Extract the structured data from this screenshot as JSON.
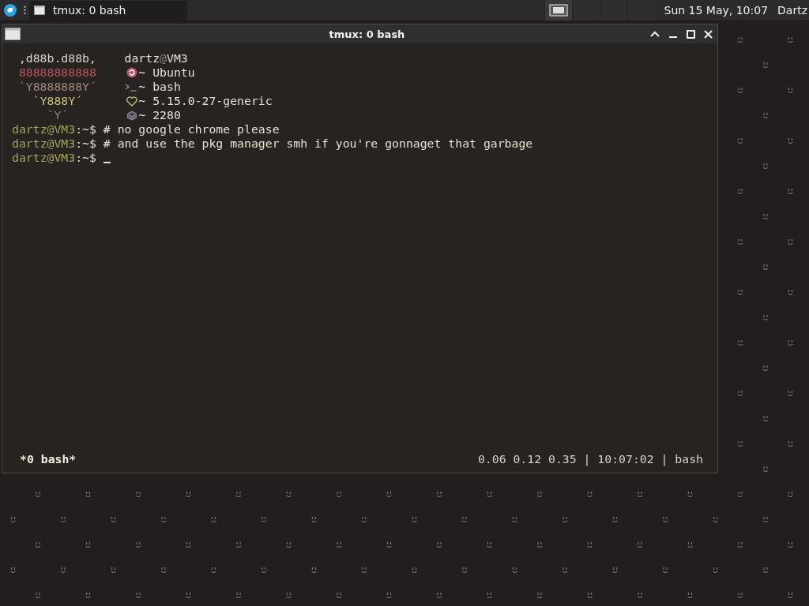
{
  "taskbar": {
    "tasks": [
      {
        "label": "tmux: 0 bash",
        "selected": true
      }
    ],
    "workspaces": [
      {
        "selected": true
      },
      {
        "selected": false
      },
      {
        "selected": false
      },
      {
        "selected": false
      }
    ],
    "clock": "Sun 15 May, 10:07",
    "user": "Dartz"
  },
  "window": {
    "title": "tmux: 0 bash"
  },
  "neofetch": {
    "logo": [
      {
        "text": ",d88b.d88b,",
        "color": "#d8d4c8"
      },
      {
        "text": "88888888888",
        "color": "#b8545c"
      },
      {
        "text": "`Y8888888Y´",
        "color": "#a08a7a"
      },
      {
        "text": "`Y888Y´",
        "color": "#c8c278"
      },
      {
        "text": "`Y´",
        "color": "#8a8478"
      }
    ],
    "user": "dartz",
    "at": "@",
    "host": "VM3",
    "info": [
      {
        "kind": "distro",
        "text": "~ Ubuntu"
      },
      {
        "kind": "shell",
        "text": "~ bash"
      },
      {
        "kind": "kernel",
        "text": "~ 5.15.0-27-generic"
      },
      {
        "kind": "packages",
        "text": "~ 2280"
      }
    ]
  },
  "lines": [
    {
      "user_host": "dartz@VM3",
      "path": ":~$",
      "command": "# no google chrome please"
    },
    {
      "user_host": "dartz@VM3",
      "path": ":~$",
      "command": "# and use the pkg manager smh if you're gonnaget that garbage"
    },
    {
      "user_host": "dartz@VM3",
      "path": ":~$"
    }
  ],
  "status_bar": {
    "window": "*0 bash*",
    "info": "0.06 0.12 0.35 | 10:07:02 | bash"
  }
}
